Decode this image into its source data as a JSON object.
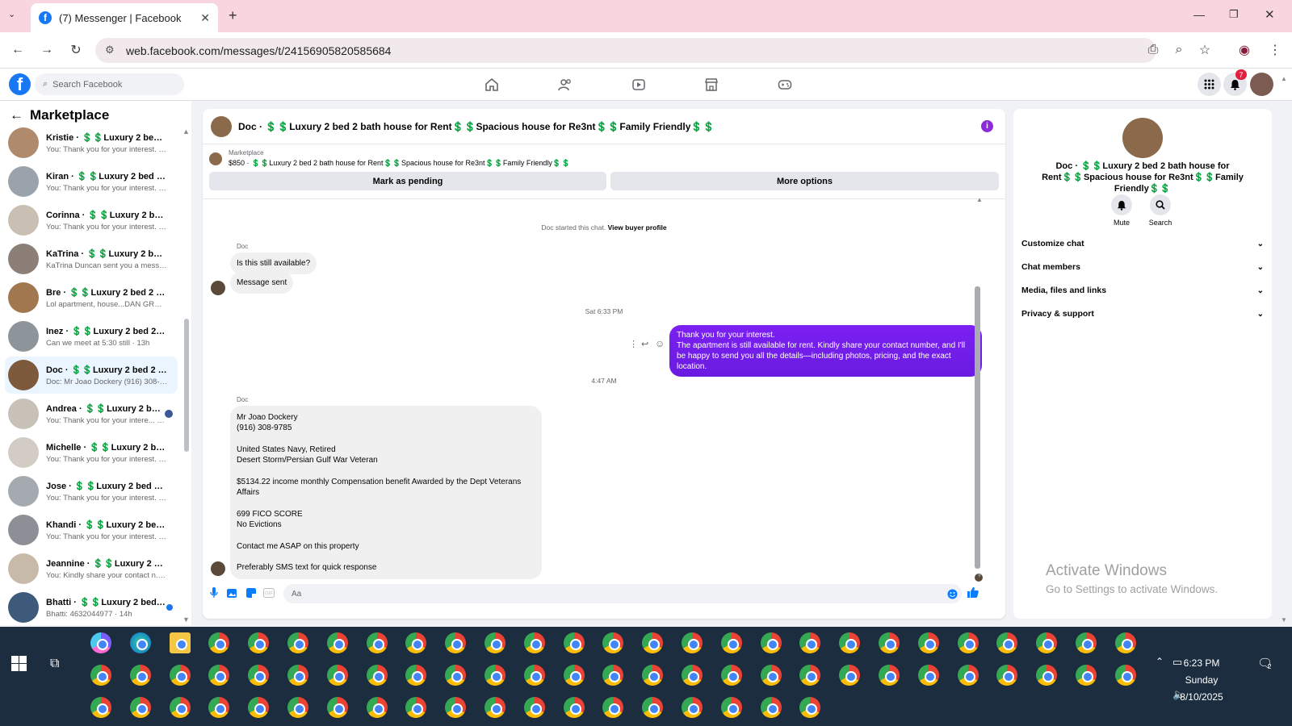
{
  "browser": {
    "tab_title": "(7) Messenger | Facebook",
    "url": "web.facebook.com/messages/t/24156905820585684"
  },
  "fb": {
    "search_placeholder": "Search Facebook",
    "notification_count": "7"
  },
  "sidebar": {
    "title": "Marketplace",
    "conversations": [
      {
        "name": "Kristie · 💲💲Luxury 2 bed 2 ba...",
        "preview": "You: Thank you for your interest. · 31m",
        "color": "#b08a6c"
      },
      {
        "name": "Kiran · 💲💲Luxury 2 bed 2 bat...",
        "preview": "You: Thank you for your interest. · 31m",
        "color": "#9aa3ab"
      },
      {
        "name": "Corinna · 💲💲Luxury 2 bed 2 ...",
        "preview": "You: Thank you for your interest. · 31m",
        "color": "#c9bfb2"
      },
      {
        "name": "KaTrina · 💲💲Luxury 2 bed 2 b...",
        "preview": "KaTrina Duncan sent you a messa... · 5h",
        "color": "#8b7f78"
      },
      {
        "name": "Bre · 💲💲Luxury 2 bed 2 bath ...",
        "preview": "Lol apartment, house...DAN GRO... · 9h",
        "color": "#a0774f"
      },
      {
        "name": "Inez · 💲💲Luxury 2 bed 2 bath...",
        "preview": "Can we meet at 5:30 still · 13h",
        "color": "#8d949a"
      },
      {
        "name": "Doc · 💲💲Luxury 2 bed 2 bath...",
        "preview": "Doc: Mr Joao Dockery (916) 308-... · 13h",
        "color": "#7d5a3c"
      },
      {
        "name": "Andrea · 💲💲Luxury 2 bed ...",
        "preview": "You: Thank you for your intere... · 14h",
        "color": "#c8c1b8"
      },
      {
        "name": "Michelle · 💲💲Luxury 2 bed 2 ...",
        "preview": "You: Thank you for your interest. ... 14h",
        "color": "#d2ccc4"
      },
      {
        "name": "Jose · 💲💲Luxury 2 bed 2 bath...",
        "preview": "You: Thank you for your interest. ... 14h",
        "color": "#a5aab0"
      },
      {
        "name": "Khandi · 💲💲Luxury 2 bed 2 b...",
        "preview": "You: Thank you for your interest. ... 14h",
        "color": "#8c9096"
      },
      {
        "name": "Jeannine · 💲💲Luxury 2 bed 2 ...",
        "preview": "You: Kindly share your contact n... · 14h",
        "color": "#c7baa9"
      },
      {
        "name": "Bhatti · 💲💲Luxury 2 bed 2 ...",
        "preview": "Bhatti: 4632044977 · 14h",
        "color": "#3e5a7a"
      }
    ]
  },
  "chat": {
    "header_title": "Doc · 💲💲Luxury 2 bed 2 bath house for Rent💲💲Spacious house for Re3nt💲💲Family Friendly💲💲",
    "listing_label": "Marketplace",
    "listing_price_line": "$850 · 💲💲Luxury 2 bed 2 bath house for Rent💲💲Spacious house for Re3nt💲💲Family Friendly💲💲",
    "mark_pending": "Mark as pending",
    "more_options": "More options",
    "started_text": "Doc started this chat.",
    "view_buyer": "View buyer profile",
    "sender_name": "Doc",
    "msg1": "Is this still available?",
    "msg2": "Message sent",
    "time1": "Sat 6:33 PM",
    "out_line1": "Thank you for your interest.",
    "out_line2": "The apartment is still available for rent. Kindly share your contact number, and I'll be happy to send you all the details—including photos, pricing, and the exact location.",
    "time2": "4:47 AM",
    "long_msg": [
      "Mr Joao Dockery",
      "(916) 308-9785",
      "",
      "United States Navy, Retired",
      "Desert Storm/Persian Gulf War Veteran",
      "",
      "$5134.22 income monthly  Compensation benefit Awarded by the Dept Veterans Affairs",
      "",
      "699 FICO SCORE",
      "No Evictions",
      "",
      "Contact me ASAP on this property",
      "",
      "Preferably SMS text for quick response"
    ],
    "input_placeholder": "Aa"
  },
  "details": {
    "title": "Doc · 💲💲Luxury 2 bed 2 bath house for Rent💲💲Spacious house for Re3nt💲💲Family Friendly💲💲",
    "mute": "Mute",
    "search": "Search",
    "rows": [
      "Customize chat",
      "Chat members",
      "Media, files and links",
      "Privacy & support"
    ]
  },
  "watermark": {
    "line1": "Activate Windows",
    "line2": "Go to Settings to activate Windows."
  },
  "taskbar": {
    "time": "6:23 PM",
    "day": "Sunday",
    "date": "8/10/2025",
    "notif_count": "2"
  }
}
